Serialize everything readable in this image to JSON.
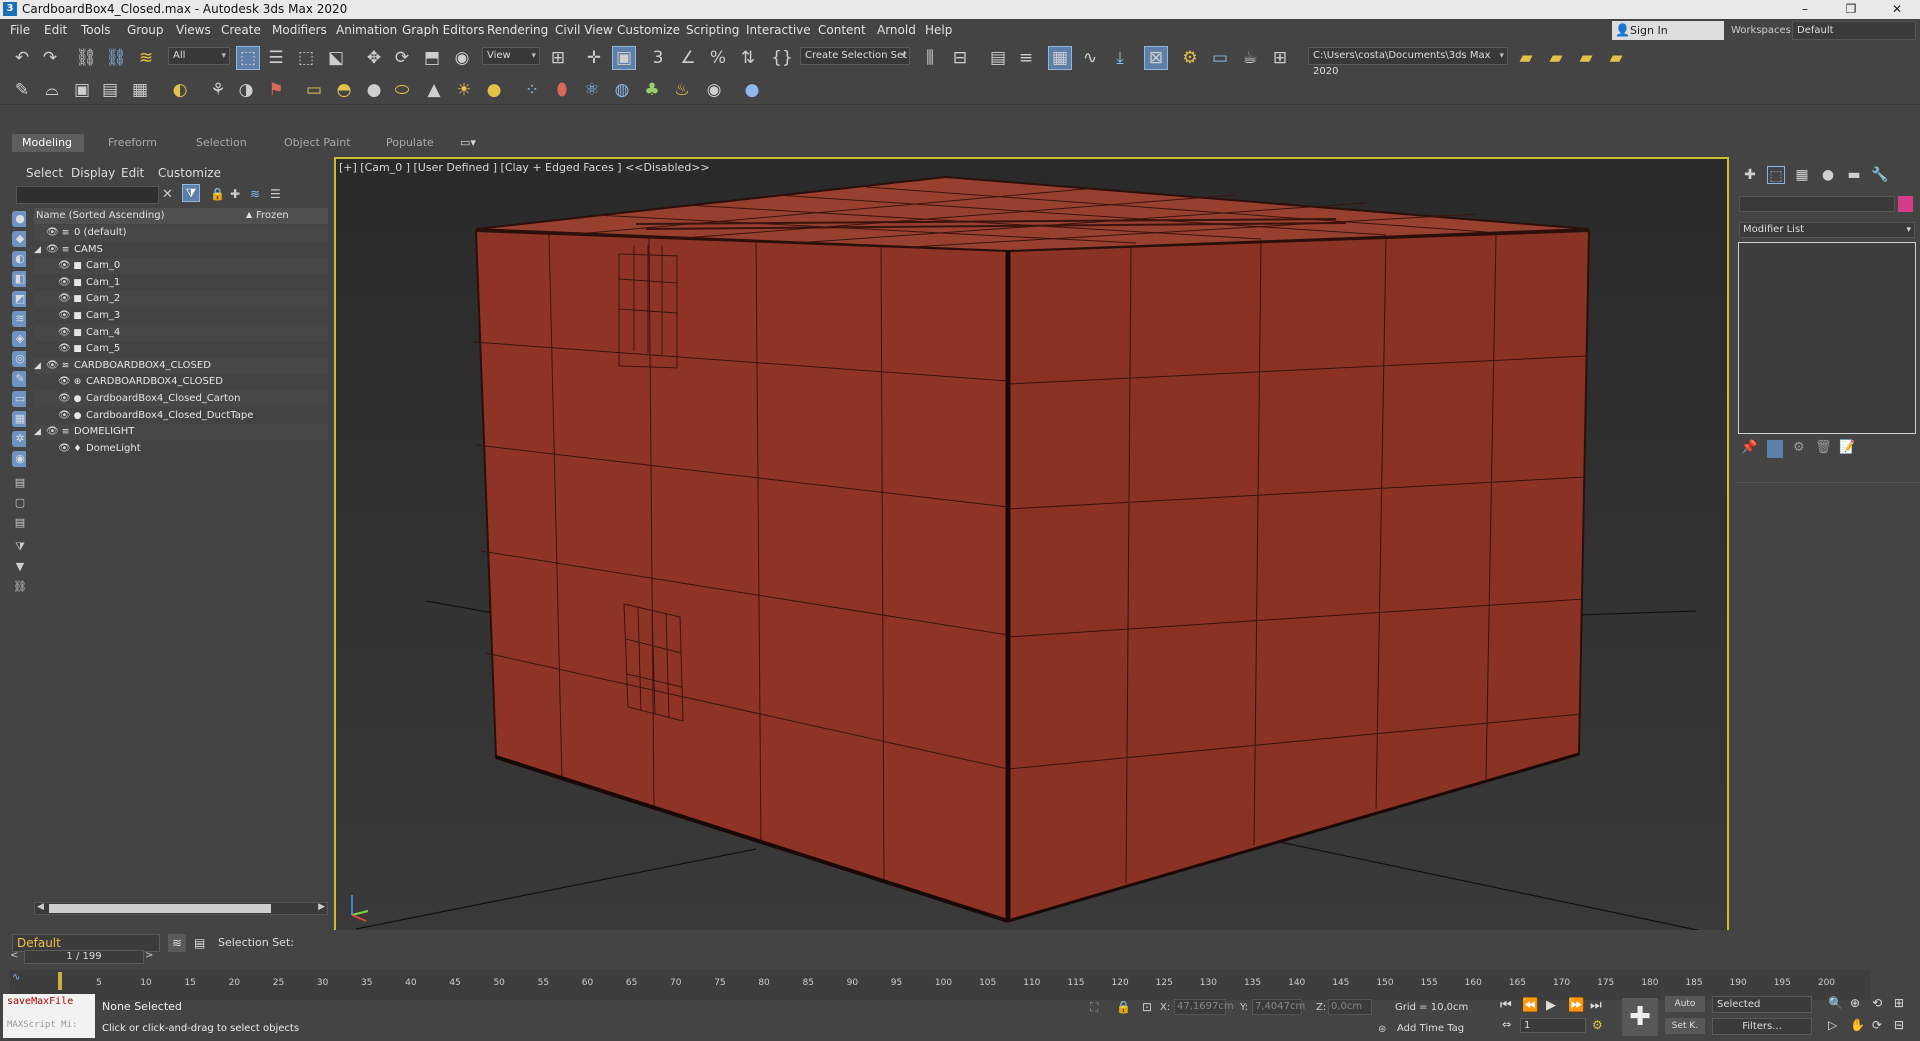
{
  "window": {
    "title": "CardboardBox4_Closed.max - Autodesk 3ds Max 2020",
    "app_icon": "3",
    "minimize": "–",
    "maximize": "❐",
    "close": "✕"
  },
  "menu": [
    "File",
    "Edit",
    "Tools",
    "Group",
    "Views",
    "Create",
    "Modifiers",
    "Animation",
    "Graph Editors",
    "Rendering",
    "Civil View",
    "Customize",
    "Scripting",
    "Interactive",
    "Content",
    "Arnold",
    "Help"
  ],
  "signin": "Sign In",
  "workspaces": {
    "label": "Workspaces:",
    "value": "Default"
  },
  "toolbar": {
    "filter_value": "All",
    "refcoord_value": "View",
    "selection_set": "Create Selection Set",
    "project_path": "C:\\Users\\costa\\Documents\\3ds Max 2020"
  },
  "ribbon_tabs": [
    "Modeling",
    "Freeform",
    "Selection",
    "Object Paint",
    "Populate"
  ],
  "explorer": {
    "tabs": [
      "Select",
      "Display",
      "Edit",
      "Customize"
    ],
    "col_name": "Name (Sorted Ascending)",
    "col_sort": "▲",
    "col_frozen": "Frozen",
    "rows": [
      {
        "label": "0 (default)",
        "depth": 0,
        "arrow": "",
        "icon": "≡"
      },
      {
        "label": "CAMS",
        "depth": 0,
        "arrow": "◢",
        "icon": "≡"
      },
      {
        "label": "Cam_0",
        "depth": 1,
        "arrow": "",
        "icon": "■"
      },
      {
        "label": "Cam_1",
        "depth": 1,
        "arrow": "",
        "icon": "■"
      },
      {
        "label": "Cam_2",
        "depth": 1,
        "arrow": "",
        "icon": "■"
      },
      {
        "label": "Cam_3",
        "depth": 1,
        "arrow": "",
        "icon": "■"
      },
      {
        "label": "Cam_4",
        "depth": 1,
        "arrow": "",
        "icon": "■"
      },
      {
        "label": "Cam_5",
        "depth": 1,
        "arrow": "",
        "icon": "■"
      },
      {
        "label": "CARDBOARDBOX4_CLOSED",
        "depth": 0,
        "arrow": "◢",
        "icon": "≋"
      },
      {
        "label": "CARDBOARDBOX4_CLOSED",
        "depth": 1,
        "arrow": "",
        "icon": "⊕"
      },
      {
        "label": "CardboardBox4_Closed_Carton",
        "depth": 1,
        "arrow": "",
        "icon": "●"
      },
      {
        "label": "CardboardBox4_Closed_DuctTape",
        "depth": 1,
        "arrow": "",
        "icon": "●"
      },
      {
        "label": "DOMELIGHT",
        "depth": 0,
        "arrow": "◢",
        "icon": "≡"
      },
      {
        "label": "DomeLight",
        "depth": 1,
        "arrow": "",
        "icon": "♦"
      }
    ]
  },
  "viewport": {
    "label": "[+] [Cam_0 ] [User Defined ] [Clay + Edged Faces ]  <<Disabled>>",
    "object_color": "#8e3426"
  },
  "command_panel": {
    "modifier_list": "Modifier List",
    "color_swatch": "#d53b86"
  },
  "bottom": {
    "layer": "Default",
    "selection_set_label": "Selection Set:",
    "frame_counter": "1 / 199",
    "ticks": [
      "5",
      "10",
      "15",
      "20",
      "25",
      "30",
      "35",
      "40",
      "45",
      "50",
      "55",
      "60",
      "65",
      "70",
      "75",
      "80",
      "85",
      "90",
      "95",
      "100",
      "105",
      "110",
      "115",
      "120",
      "125",
      "130",
      "135",
      "140",
      "145",
      "150",
      "155",
      "160",
      "165",
      "170",
      "175",
      "180",
      "185",
      "190",
      "195",
      "200"
    ],
    "maxscript_line1": "saveMaxFile",
    "maxscript_line2": "MAXScript Mi:",
    "status_selected": "None Selected",
    "status_prompt": "Click or click-and-drag to select objects",
    "x_label": "X:",
    "x_value": "47,1697cm",
    "y_label": "Y:",
    "y_value": "7,4047cm",
    "z_label": "Z:",
    "z_value": "0,0cm",
    "grid": "Grid = 10,0cm",
    "add_time_tag": "Add Time Tag",
    "auto_key": "Auto",
    "set_key": "Set K.",
    "selected_combo": "Selected",
    "filters": "Filters...",
    "current_frame": "1"
  }
}
